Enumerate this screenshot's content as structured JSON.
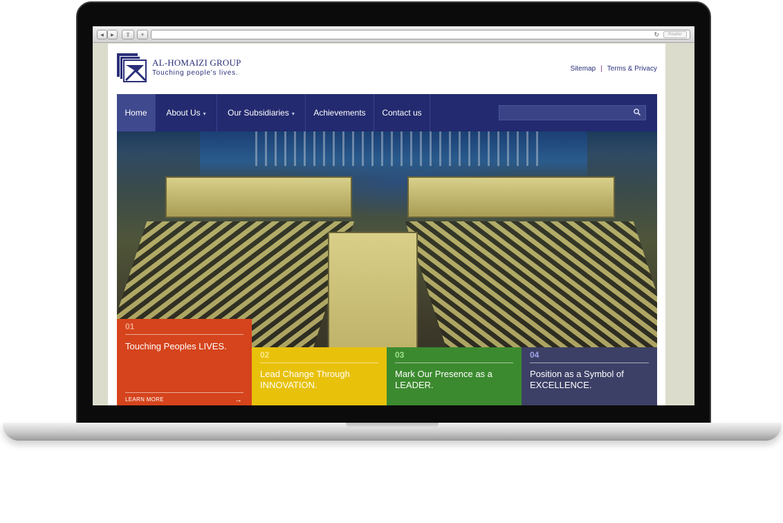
{
  "browser": {
    "back_label": "◂",
    "forward_label": "▸",
    "share_label": "⇪",
    "new_tab_label": "+",
    "reader_label": "Reader"
  },
  "header": {
    "brand_name": "AL-HOMAIZI GROUP",
    "tagline": "Touching people's lives.",
    "links": [
      "Sitemap",
      "Terms & Privacy"
    ]
  },
  "nav": {
    "items": [
      {
        "label": "Home"
      },
      {
        "label": "About Us"
      },
      {
        "label": "Our Subsidiaries"
      },
      {
        "label": "Achievements"
      },
      {
        "label": "Contact us"
      }
    ],
    "search_placeholder": ""
  },
  "tiles": [
    {
      "num": "01",
      "text": "Touching Peoples LIVES.",
      "more": "LEARN MORE",
      "color": "#d5441c"
    },
    {
      "num": "02",
      "text": "Lead Change Through INNOVATION.",
      "color": "#e8c10b"
    },
    {
      "num": "03",
      "text": "Mark Our Presence as a LEADER.",
      "color": "#3c8a2f"
    },
    {
      "num": "04",
      "text": "Position as a Symbol of EXCELLENCE.",
      "color": "#3d4066"
    }
  ],
  "colors": {
    "nav_bg": "#232a6f",
    "brand": "#2a2f78"
  }
}
